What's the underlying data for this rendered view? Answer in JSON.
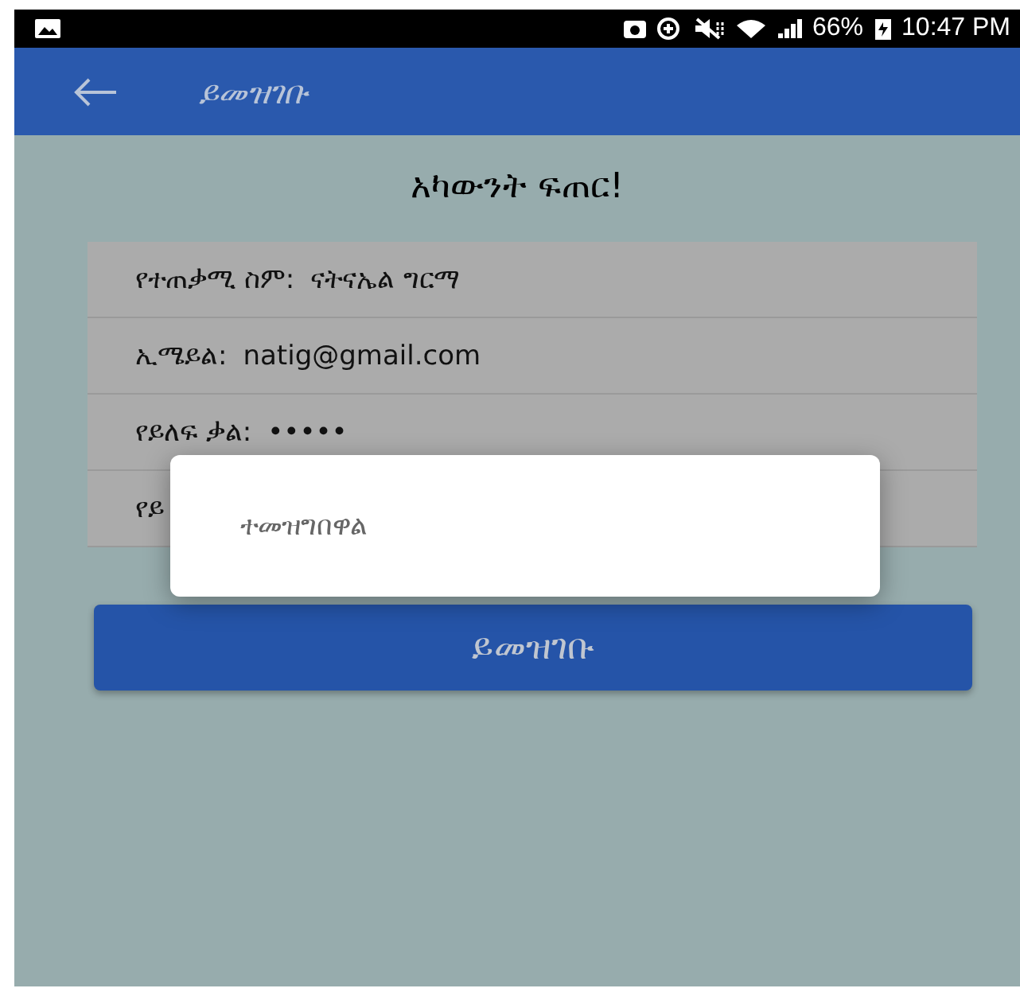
{
  "status_bar": {
    "battery": "66%",
    "time": "10:47 PM"
  },
  "app_bar": {
    "title": "ይመዝገቡ"
  },
  "heading": "አካውንት ፍጠር!",
  "fields": [
    {
      "label": "የተጠቃሚ ስም:",
      "value": "ናትናኤል ግርማ"
    },
    {
      "label": "ኢሜይል:",
      "value": "natig@gmail.com"
    },
    {
      "label": "የይለፍ ቃል:",
      "value": "•••••"
    },
    {
      "label": "የይ"
    }
  ],
  "submit_button": "ይመዝገቡ",
  "dialog": {
    "message": "ተመዝግበዋል"
  }
}
